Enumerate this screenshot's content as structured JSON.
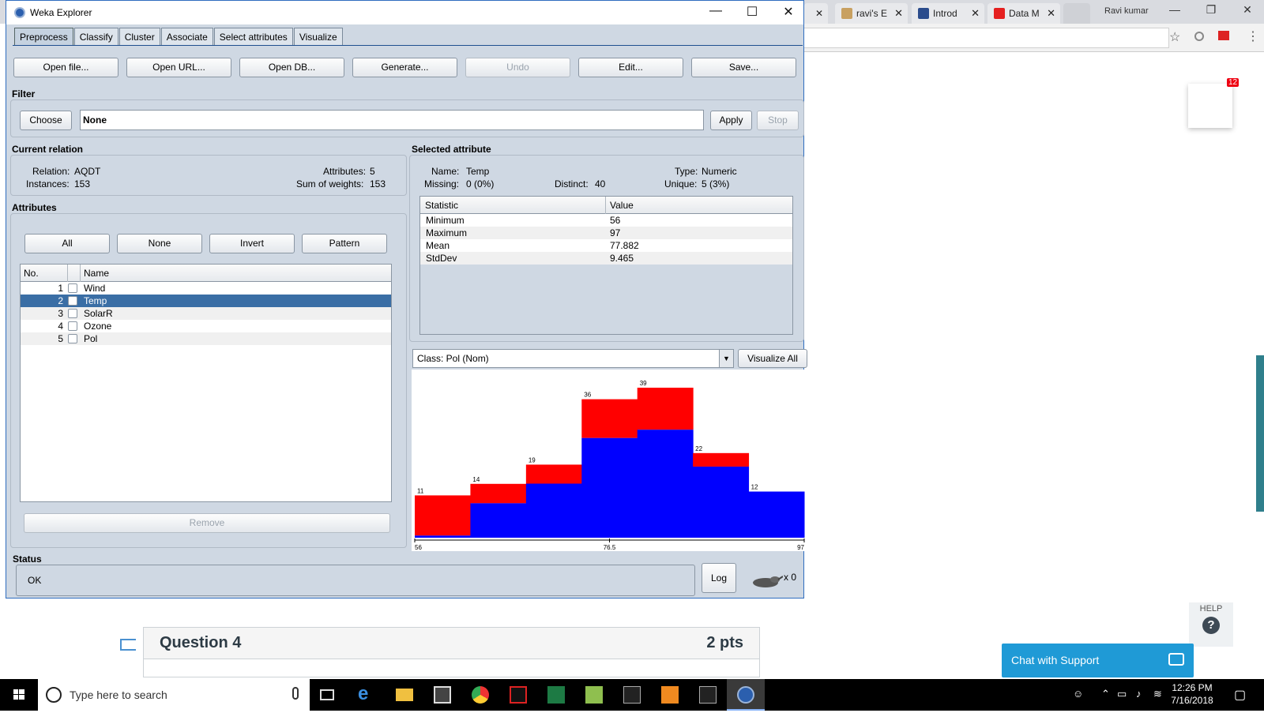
{
  "browser": {
    "tabs": [
      {
        "label": "ravi's E",
        "icon": "image-icon"
      },
      {
        "label": "Introd",
        "icon": "shield-icon"
      },
      {
        "label": "Data M",
        "icon": "youtube-icon"
      }
    ],
    "user": "Ravi kumar"
  },
  "notification_count": "12",
  "help": {
    "label": "HELP"
  },
  "chat_support": "Chat with Support",
  "question": {
    "title": "Question 4",
    "points": "2 pts"
  },
  "weka": {
    "title": "Weka Explorer",
    "tabs": [
      "Preprocess",
      "Classify",
      "Cluster",
      "Associate",
      "Select attributes",
      "Visualize"
    ],
    "active_tab": "Preprocess",
    "toolbar": {
      "open_file": "Open file...",
      "open_url": "Open URL...",
      "open_db": "Open DB...",
      "generate": "Generate...",
      "undo": "Undo",
      "edit": "Edit...",
      "save": "Save..."
    },
    "filter": {
      "label": "Filter",
      "choose": "Choose",
      "value": "None",
      "apply": "Apply",
      "stop": "Stop"
    },
    "current_relation": {
      "label": "Current relation",
      "relation_label": "Relation:",
      "relation": "AQDT",
      "instances_label": "Instances:",
      "instances": "153",
      "attributes_label": "Attributes:",
      "attributes": "5",
      "sum_weights_label": "Sum of weights:",
      "sum_weights": "153"
    },
    "attributes": {
      "label": "Attributes",
      "buttons": {
        "all": "All",
        "none": "None",
        "invert": "Invert",
        "pattern": "Pattern"
      },
      "columns": {
        "no": "No.",
        "name": "Name"
      },
      "rows": [
        {
          "no": "1",
          "name": "Wind"
        },
        {
          "no": "2",
          "name": "Temp"
        },
        {
          "no": "3",
          "name": "SolarR"
        },
        {
          "no": "4",
          "name": "Ozone"
        },
        {
          "no": "5",
          "name": "Pol"
        }
      ],
      "selected": "Temp",
      "remove": "Remove"
    },
    "selected_attribute": {
      "label": "Selected attribute",
      "name_label": "Name:",
      "name": "Temp",
      "type_label": "Type:",
      "type": "Numeric",
      "missing_label": "Missing:",
      "missing": "0 (0%)",
      "distinct_label": "Distinct:",
      "distinct": "40",
      "unique_label": "Unique:",
      "unique": "5 (3%)",
      "columns": {
        "statistic": "Statistic",
        "value": "Value"
      },
      "stats": [
        {
          "statistic": "Minimum",
          "value": "56"
        },
        {
          "statistic": "Maximum",
          "value": "97"
        },
        {
          "statistic": "Mean",
          "value": "77.882"
        },
        {
          "statistic": "StdDev",
          "value": "9.465"
        }
      ]
    },
    "class_selector": "Class: Pol (Nom)",
    "visualize_all": "Visualize All",
    "histogram": {
      "counts": [
        11,
        14,
        19,
        36,
        39,
        22,
        12
      ],
      "blue_fraction": [
        0.05,
        0.64,
        0.74,
        0.72,
        0.72,
        0.84,
        1.0
      ],
      "x_min": "56",
      "x_mid": "76.5",
      "x_max": "97",
      "colors": {
        "red": "#ff0000",
        "blue": "#0000ff"
      }
    },
    "status": {
      "label": "Status",
      "text": "OK",
      "log": "Log",
      "tasks": "x 0"
    }
  },
  "taskbar": {
    "search_placeholder": "Type here to search",
    "time": "12:26 PM",
    "date": "7/16/2018"
  }
}
